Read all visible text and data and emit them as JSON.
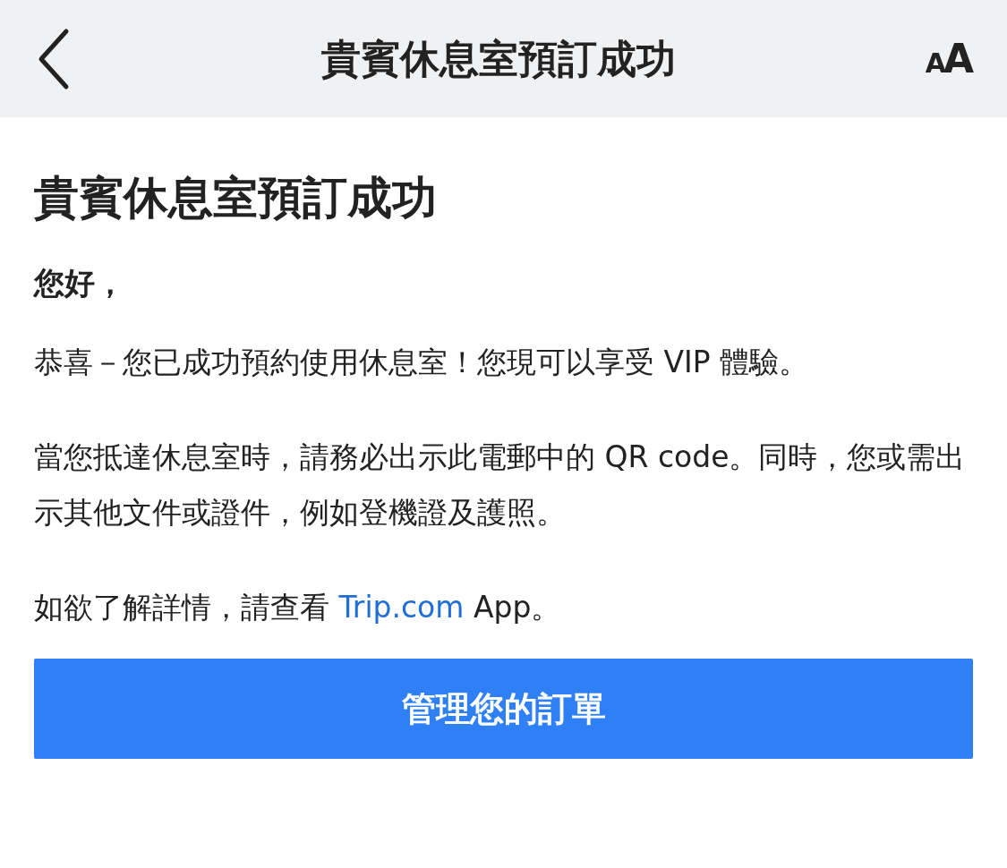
{
  "header": {
    "title": "貴賓休息室預訂成功",
    "text_size_button": "AA"
  },
  "content": {
    "heading": "貴賓休息室預訂成功",
    "greeting": "您好，",
    "paragraphs": [
      {
        "text": "恭喜－您已成功預約使用休息室！您現可以享受 VIP 體驗。"
      },
      {
        "text": "當您抵達休息室時，請務必出示此電郵中的 QR code。同時，您或需出示其他文件或證件，例如登機證及護照。"
      },
      {
        "before": "如欲了解詳情，請查看 ",
        "link": "Trip.com",
        "after": " App。"
      }
    ],
    "button": "管理您的訂單"
  }
}
